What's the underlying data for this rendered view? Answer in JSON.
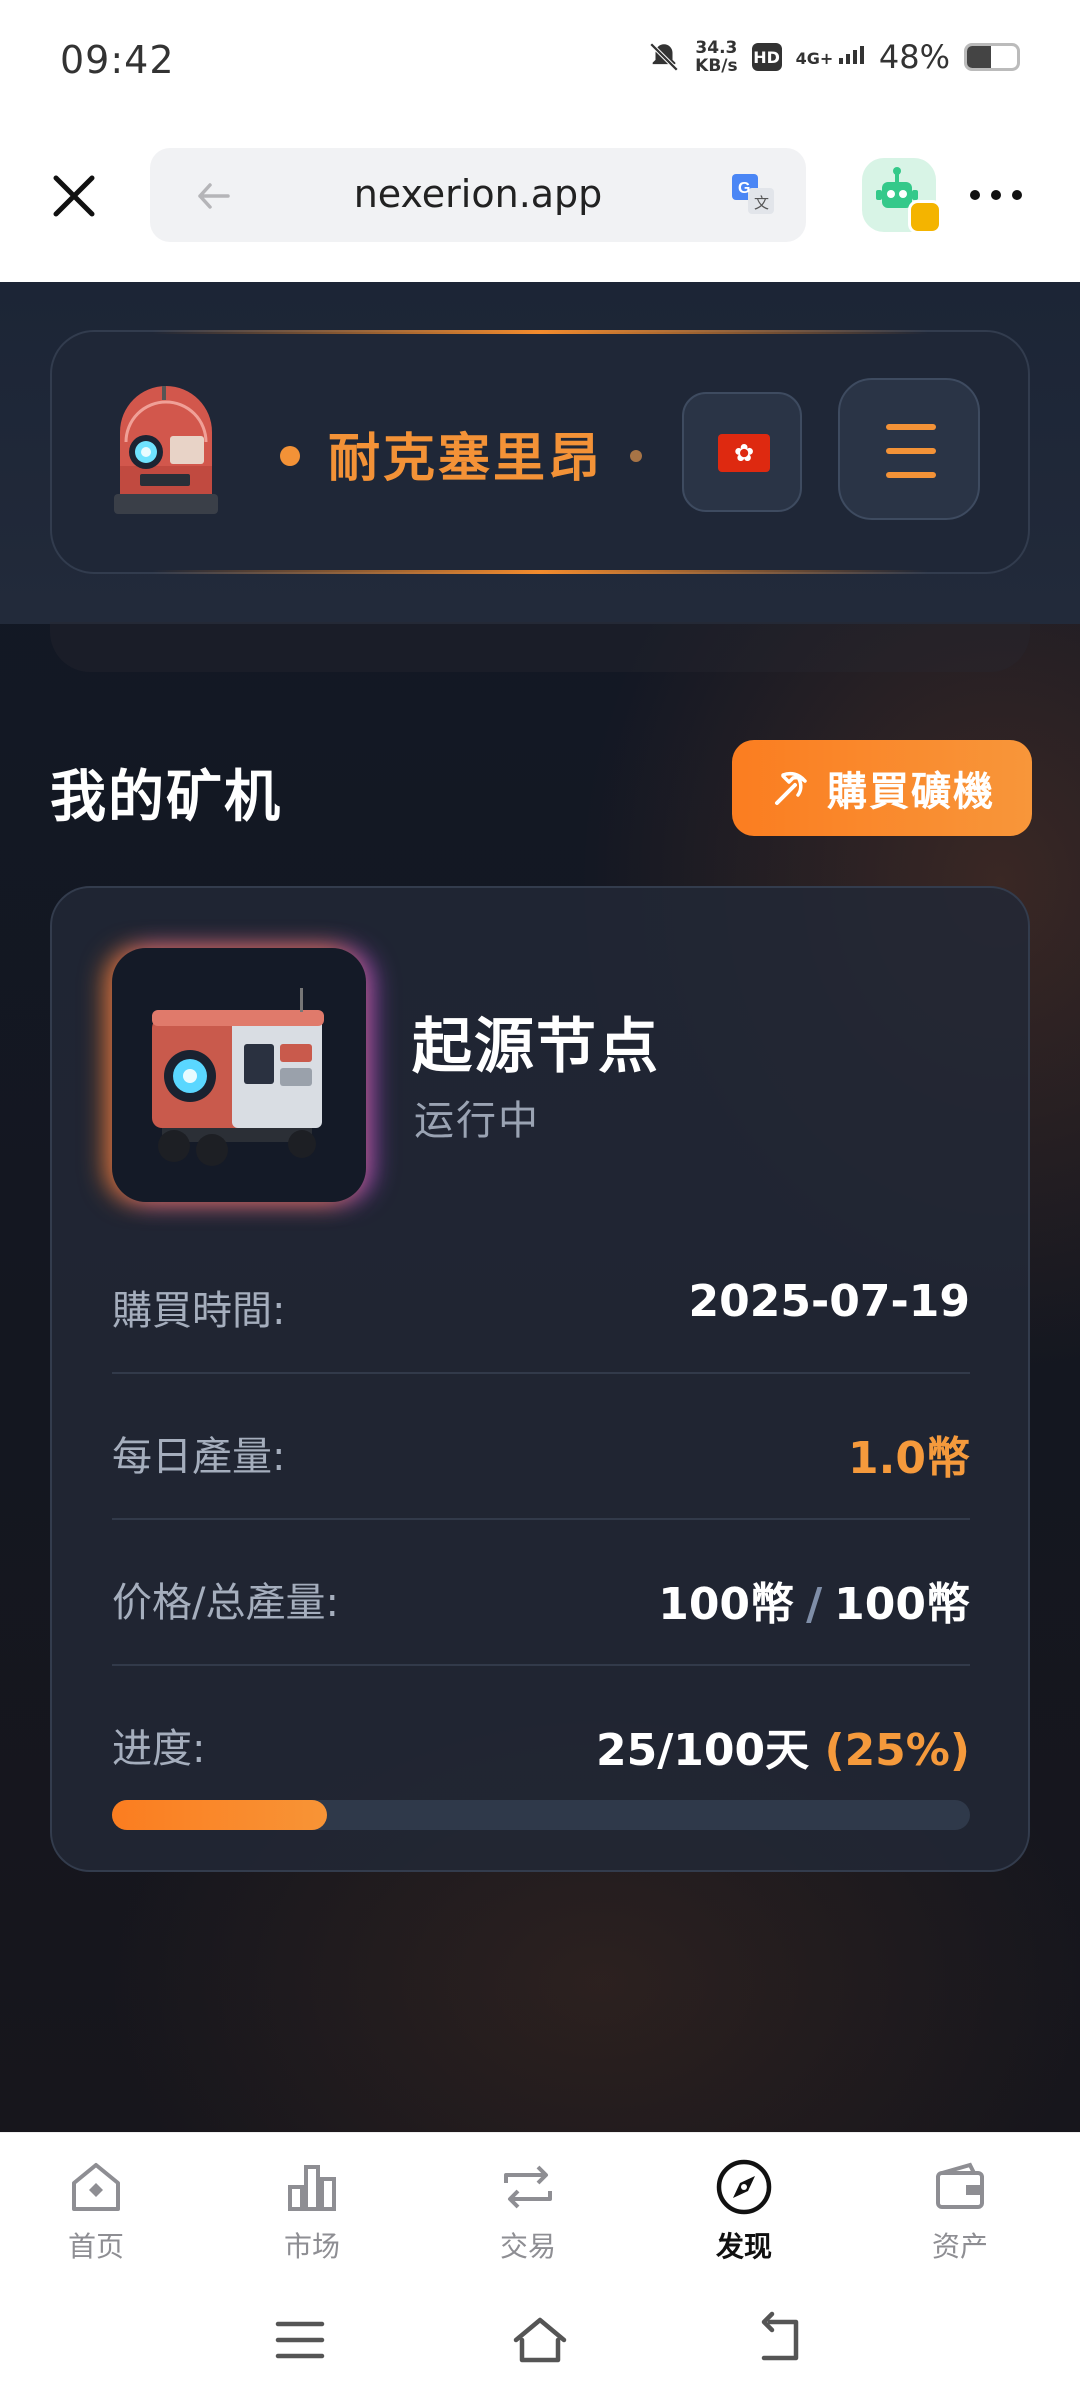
{
  "status_bar": {
    "time": "09:42",
    "speed_value": "34.3",
    "speed_unit": "KB/s",
    "hd": "HD",
    "signal": "4G+",
    "battery": "48%",
    "battery_level": 0.48
  },
  "browser": {
    "url": "nexerion.app",
    "icons": [
      "close-icon",
      "back-arrow-icon",
      "translate-icon",
      "bot-icon",
      "more-icon"
    ]
  },
  "header": {
    "brand": "耐克塞里昂",
    "flag_text": "✿",
    "accent": "#f39237"
  },
  "section": {
    "title": "我的矿机",
    "buy_button": "購買礦機"
  },
  "miner": {
    "name": "起源节点",
    "status": "运行中",
    "rows": [
      {
        "label": "購買時間:",
        "value": "2025-07-19"
      },
      {
        "label": "每日產量:",
        "value": "1.0幣"
      },
      {
        "label": "价格/总產量:",
        "value_a": "100幣",
        "sep": "/",
        "value_b": "100幣"
      },
      {
        "label": "进度:",
        "value_a": "25/100天",
        "value_b": "(25%)"
      }
    ],
    "progress": 0.25
  },
  "bottom_nav": {
    "items": [
      {
        "label": "首页",
        "icon": "home-icon"
      },
      {
        "label": "市场",
        "icon": "bar-chart-icon"
      },
      {
        "label": "交易",
        "icon": "swap-icon"
      },
      {
        "label": "发现",
        "icon": "compass-icon",
        "active": true
      },
      {
        "label": "资产",
        "icon": "wallet-icon"
      }
    ]
  },
  "system_nav": [
    "menu-icon",
    "home-outline-icon",
    "back-icon"
  ]
}
